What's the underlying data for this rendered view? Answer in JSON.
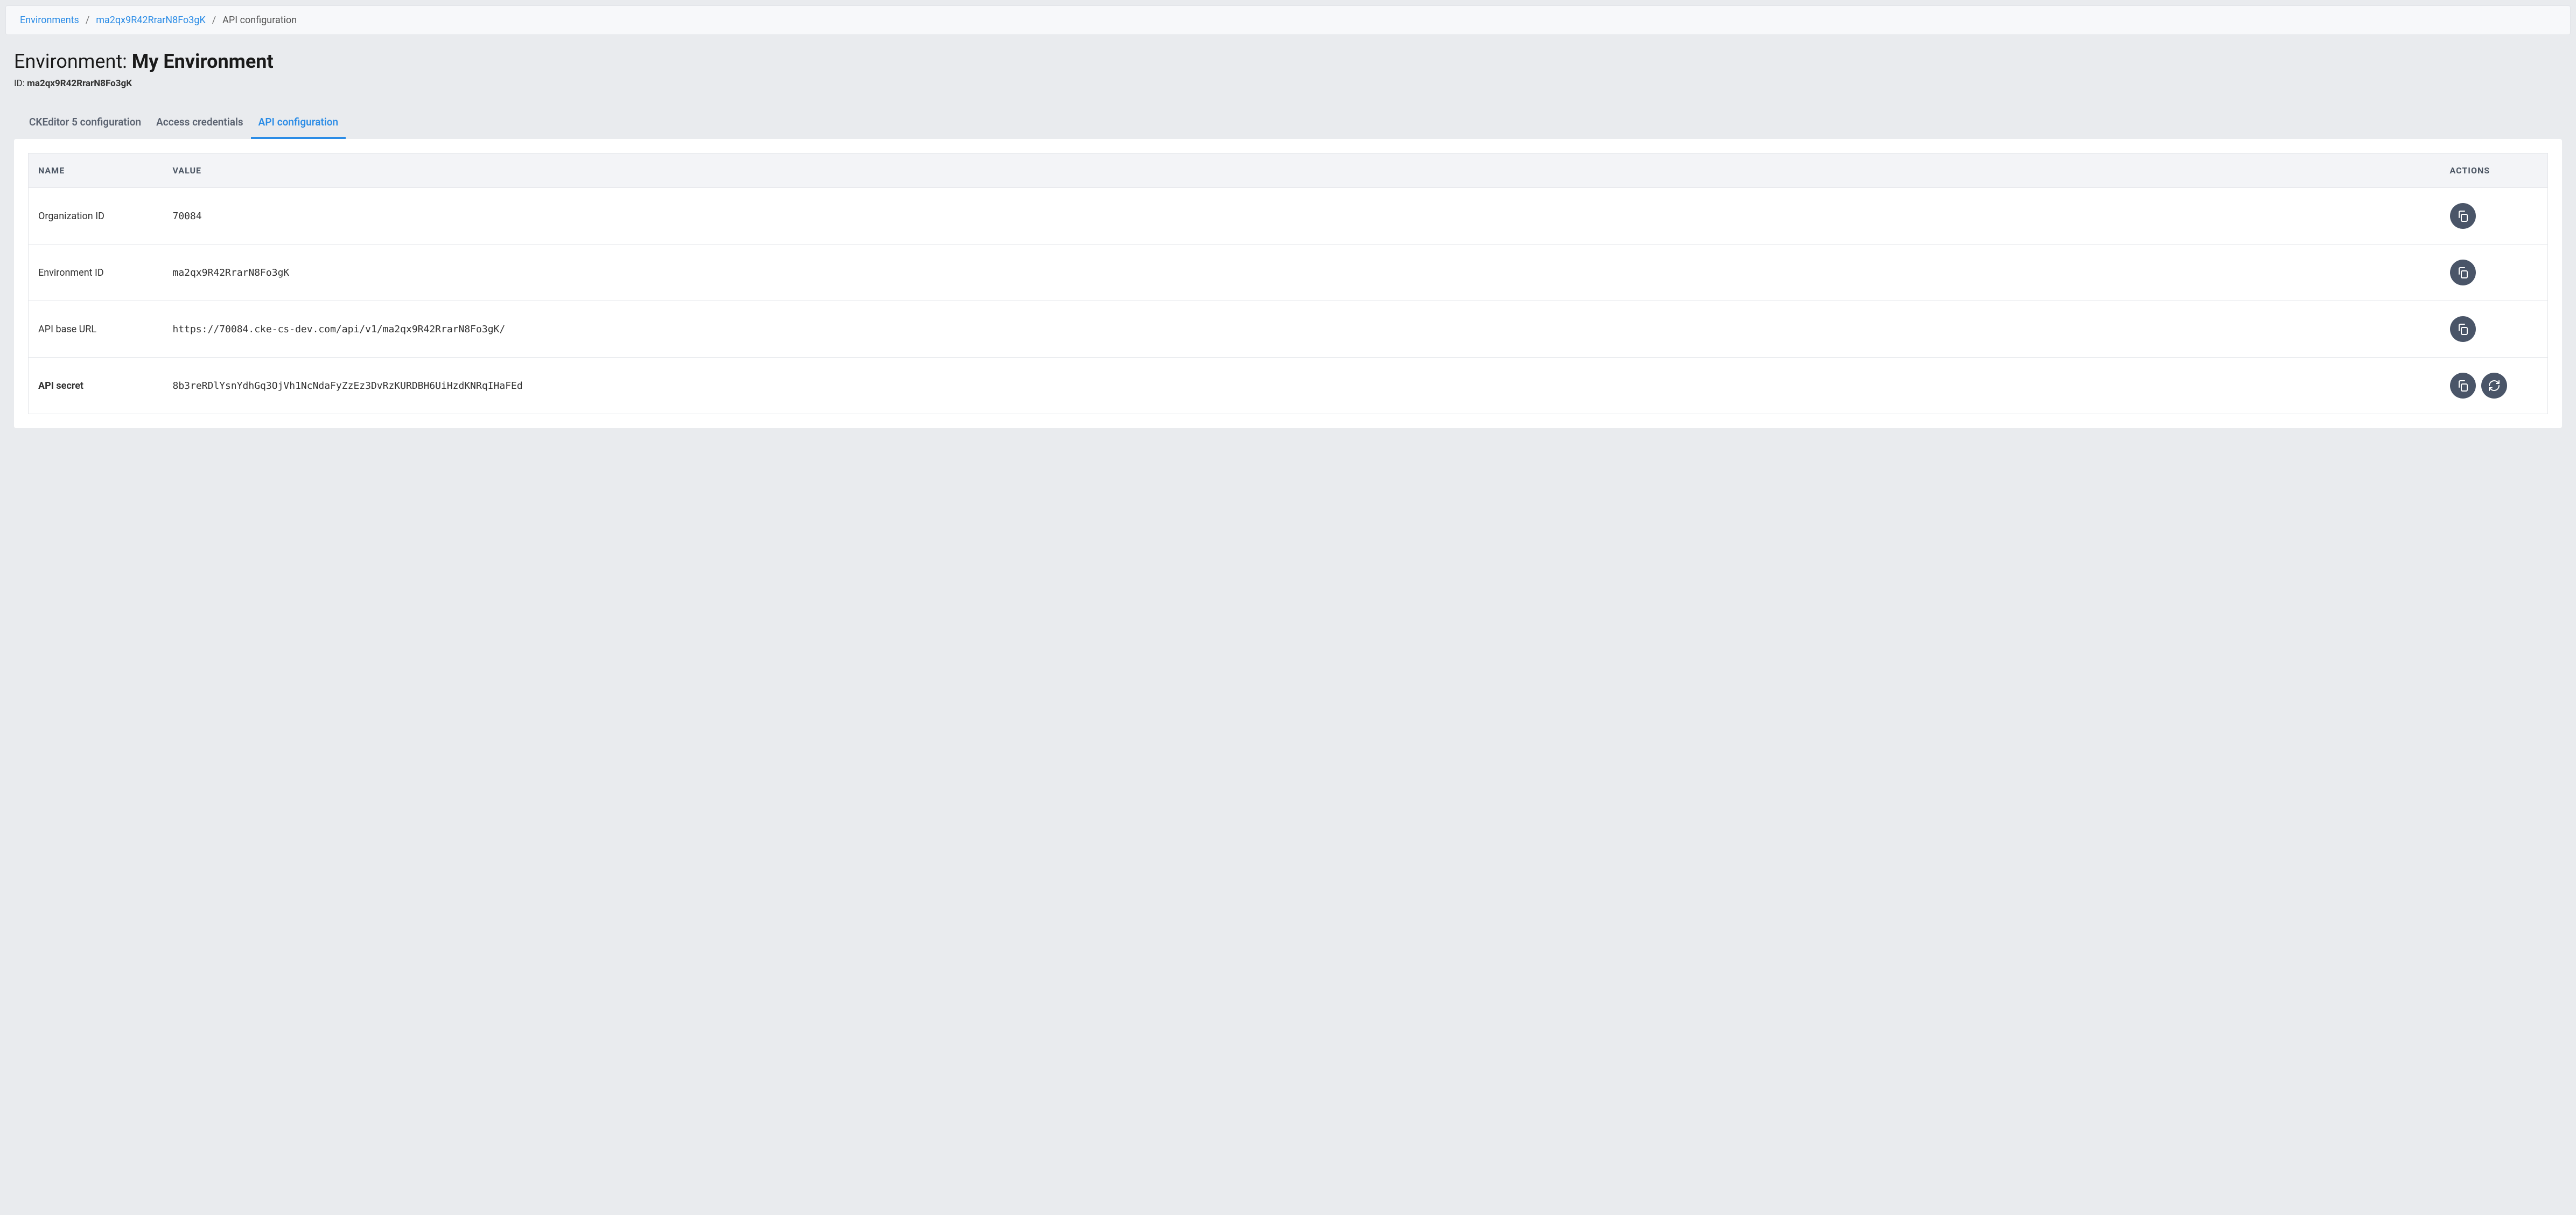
{
  "breadcrumb": {
    "items": [
      {
        "label": "Environments",
        "link": true
      },
      {
        "label": "ma2qx9R42RrarN8Fo3gK",
        "link": true
      },
      {
        "label": "API configuration",
        "link": false
      }
    ]
  },
  "header": {
    "title_prefix": "Environment: ",
    "title_name": "My Environment",
    "id_label": "ID: ",
    "id_value": "ma2qx9R42RrarN8Fo3gK"
  },
  "tabs": [
    {
      "label": "CKEditor 5 configuration",
      "active": false
    },
    {
      "label": "Access credentials",
      "active": false
    },
    {
      "label": "API configuration",
      "active": true
    }
  ],
  "table": {
    "headers": {
      "name": "NAME",
      "value": "VALUE",
      "actions": "ACTIONS"
    },
    "rows": [
      {
        "name": "Organization ID",
        "value": "70084",
        "bold": false,
        "actions": [
          "copy"
        ]
      },
      {
        "name": "Environment ID",
        "value": "ma2qx9R42RrarN8Fo3gK",
        "bold": false,
        "actions": [
          "copy"
        ]
      },
      {
        "name": "API base URL",
        "value": "https://70084.cke-cs-dev.com/api/v1/ma2qx9R42RrarN8Fo3gK/",
        "bold": false,
        "actions": [
          "copy"
        ]
      },
      {
        "name": "API secret",
        "value": "8b3reRDlYsnYdhGq3OjVh1NcNdaFyZzEz3DvRzKURDBH6UiHzdKNRqIHaFEd",
        "bold": true,
        "actions": [
          "copy",
          "refresh"
        ]
      }
    ]
  },
  "icons": {
    "copy": "copy-icon",
    "refresh": "refresh-icon"
  }
}
